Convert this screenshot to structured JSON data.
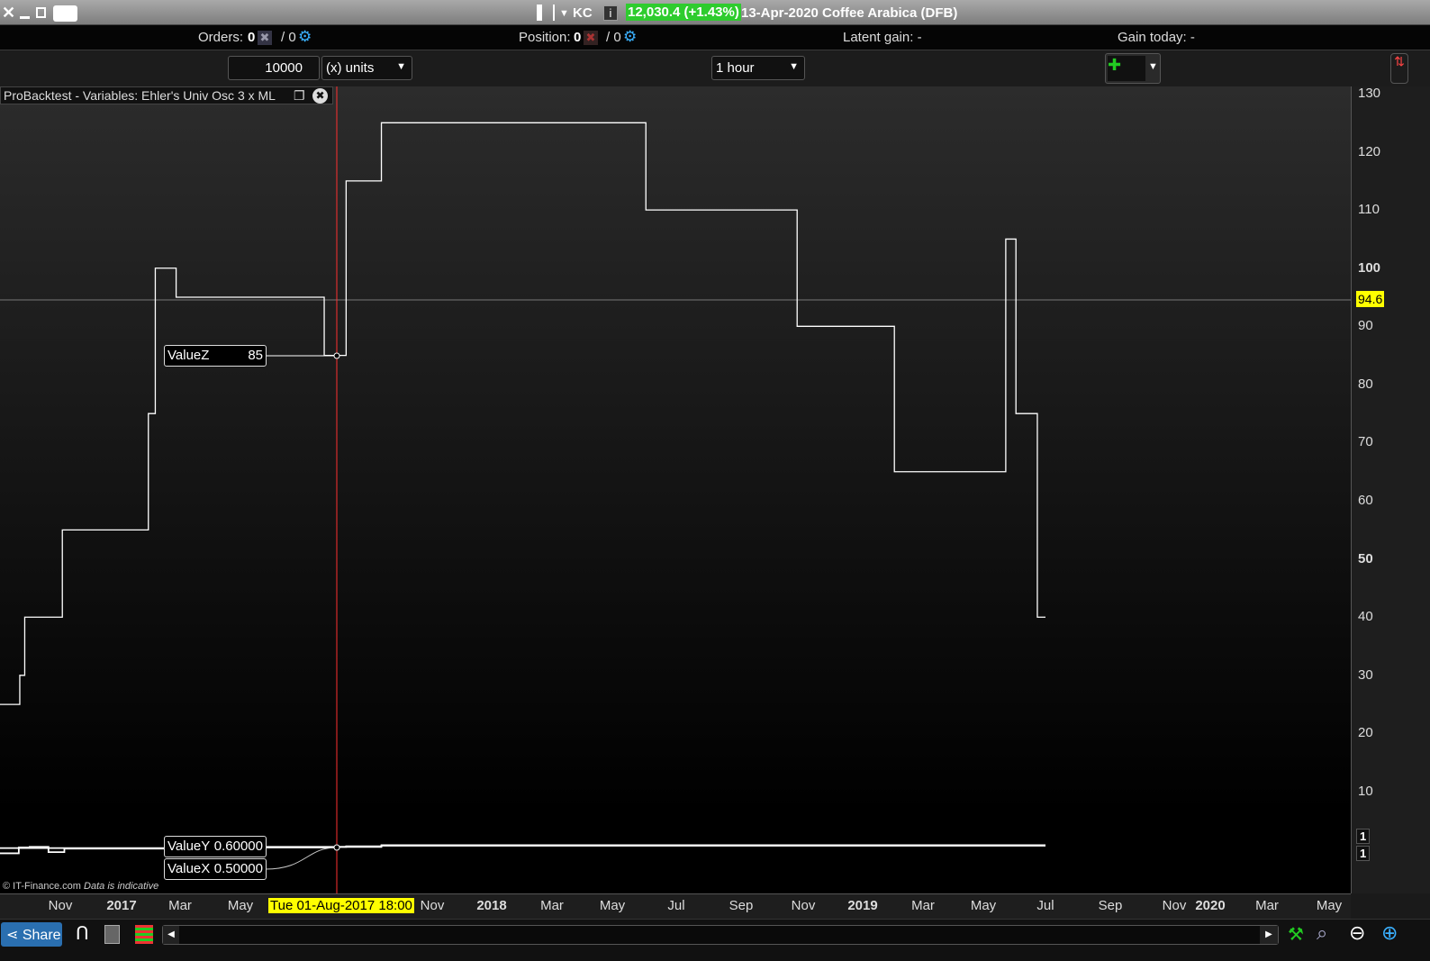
{
  "window": {
    "symbol": "KC",
    "price": "12,030.4 (+1.43%)",
    "title": "13-Apr-2020 Coffee Arabica (DFB)",
    "price_color": "#2ecc2e"
  },
  "infobar": {
    "orders_label": "Orders:",
    "orders_value": "0",
    "orders_pending": "/ 0",
    "position_label": "Position:",
    "position_value": "0",
    "position_pending": "/ 0",
    "latent_gain": "Latent gain: -",
    "gain_today": "Gain today: -"
  },
  "toolbar": {
    "quantity": "10000",
    "unit": "(x) units",
    "timeframe": "1 hour"
  },
  "panel": {
    "title": "ProBacktest - Variables: Ehler's Univ Osc 3 x ML"
  },
  "footer": {
    "copyright": "© IT-Finance.com",
    "disclaimer": "Data is indicative",
    "share": "Share"
  },
  "cursor": {
    "date_label": "Tue 01-Aug-2017 18:00",
    "price_label": "94.6",
    "cursor_color": "#ff3030",
    "highlight_color": "#ffff00"
  },
  "tooltips": [
    {
      "name": "ValueZ",
      "value": "85"
    },
    {
      "name": "ValueY",
      "value": "0.60000"
    },
    {
      "name": "ValueX",
      "value": "0.50000"
    }
  ],
  "right_badges": [
    "1",
    "1"
  ],
  "chart_data": {
    "type": "line",
    "step": true,
    "ylim": [
      0,
      130
    ],
    "yticks": [
      "130",
      "120",
      "110",
      "100",
      "90",
      "80",
      "70",
      "60",
      "50",
      "40",
      "30",
      "20",
      "10"
    ],
    "xticks": [
      "Nov",
      "2017",
      "Mar",
      "May",
      "Nov",
      "2018",
      "Mar",
      "May",
      "Jul",
      "Sep",
      "Nov",
      "2019",
      "Mar",
      "May",
      "Jul",
      "Sep",
      "Nov",
      "2020",
      "Mar",
      "May"
    ],
    "grid": false,
    "series": [
      {
        "name": "ValueZ",
        "color": "#ffffff",
        "points": [
          [
            "2016-09-01",
            25
          ],
          [
            "2016-09-21",
            30
          ],
          [
            "2016-09-26",
            40
          ],
          [
            "2016-11-03",
            55
          ],
          [
            "2017-01-28",
            75
          ],
          [
            "2017-02-04",
            100
          ],
          [
            "2017-02-25",
            95
          ],
          [
            "2017-07-20",
            85
          ],
          [
            "2017-08-10",
            115
          ],
          [
            "2017-09-13",
            125
          ],
          [
            "2018-06-02",
            110
          ],
          [
            "2018-10-26",
            90
          ],
          [
            "2019-02-01",
            65
          ],
          [
            "2019-05-23",
            105
          ],
          [
            "2019-06-02",
            75
          ],
          [
            "2019-06-23",
            40
          ],
          [
            "2019-07-01",
            40
          ]
        ]
      },
      {
        "name": "ValueY",
        "color": "#ffffff",
        "points": [
          [
            "2016-09-01",
            -0.6
          ],
          [
            "2016-09-20",
            0.4
          ],
          [
            "2016-10-01",
            0.5
          ],
          [
            "2016-10-20",
            -0.4
          ],
          [
            "2016-11-05",
            0.2
          ],
          [
            "2017-02-20",
            0.5
          ],
          [
            "2017-08-10",
            0.6
          ],
          [
            "2017-09-13",
            0.8
          ],
          [
            "2019-07-01",
            0.8
          ]
        ]
      },
      {
        "name": "ValueX",
        "color": "#ffffff",
        "points": [
          [
            "2016-09-01",
            0.3
          ],
          [
            "2017-02-20",
            0.4
          ],
          [
            "2017-08-01",
            0.5
          ],
          [
            "2017-09-13",
            0.7
          ],
          [
            "2019-07-01",
            0.7
          ]
        ]
      }
    ]
  }
}
